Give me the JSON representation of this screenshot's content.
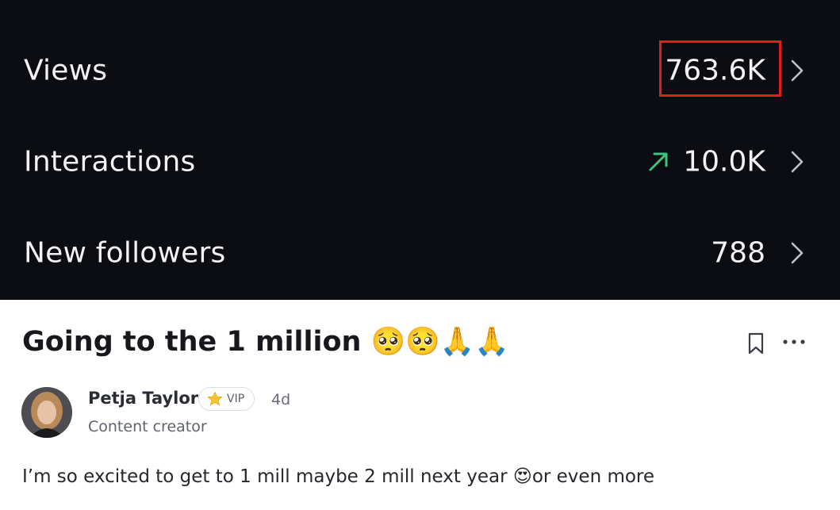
{
  "stats": [
    {
      "label": "Views",
      "value": "763.6K",
      "trend": null,
      "highlighted": true
    },
    {
      "label": "Interactions",
      "value": "10.0K",
      "trend": "up-arrow-icon",
      "highlighted": false
    },
    {
      "label": "New followers",
      "value": "788",
      "trend": null,
      "highlighted": false
    }
  ],
  "colors": {
    "stats_background": "#0b0d12",
    "trend_up": "#3cc47c",
    "highlight_border": "#e01e1e"
  },
  "post": {
    "title": "Going to the 1 million 🥺🥺🙏🙏",
    "author": {
      "name": "Petja Taylor",
      "badge": "VIP",
      "badge_icon": "star-icon",
      "age": "4d",
      "role": "Content creator"
    },
    "body": "I’m so excited to get to 1 mill maybe 2 mill next year 😍or even more"
  }
}
